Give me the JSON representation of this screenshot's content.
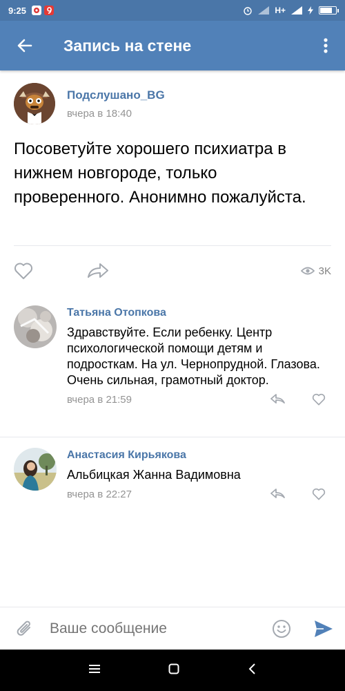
{
  "status_bar": {
    "time": "9:25",
    "network": "H+"
  },
  "header": {
    "title": "Запись на стене"
  },
  "post": {
    "author": "Подслушано_BG",
    "time": "вчера в 18:40",
    "text": "Посоветуйте хорошего психиатра в нижнем новгороде, только проверенного. Анонимно пожалуйста.",
    "views": "3K"
  },
  "comments": [
    {
      "author": "Татьяна Отопкова",
      "text": "Здравствуйте. Если ребенку. Центр психологической помощи детям и подросткам. На ул. Чернопрудной. Глазова. Очень сильная, грамотный доктор.",
      "time": "вчера в 21:59"
    },
    {
      "author": "Анастасия Кирьякова",
      "text": "Альбицкая Жанна Вадимовна",
      "time": "вчера в 22:27"
    }
  ],
  "composer": {
    "placeholder": "Ваше сообщение"
  },
  "colors": {
    "header": "#5181b8",
    "status": "#4a76a8",
    "link": "#4a76a8",
    "send": "#5181b8"
  },
  "icons": [
    "back-arrow-icon",
    "more-vertical-icon",
    "heart-icon",
    "share-icon",
    "eye-icon",
    "reply-icon",
    "paperclip-icon",
    "smile-icon",
    "send-icon"
  ]
}
